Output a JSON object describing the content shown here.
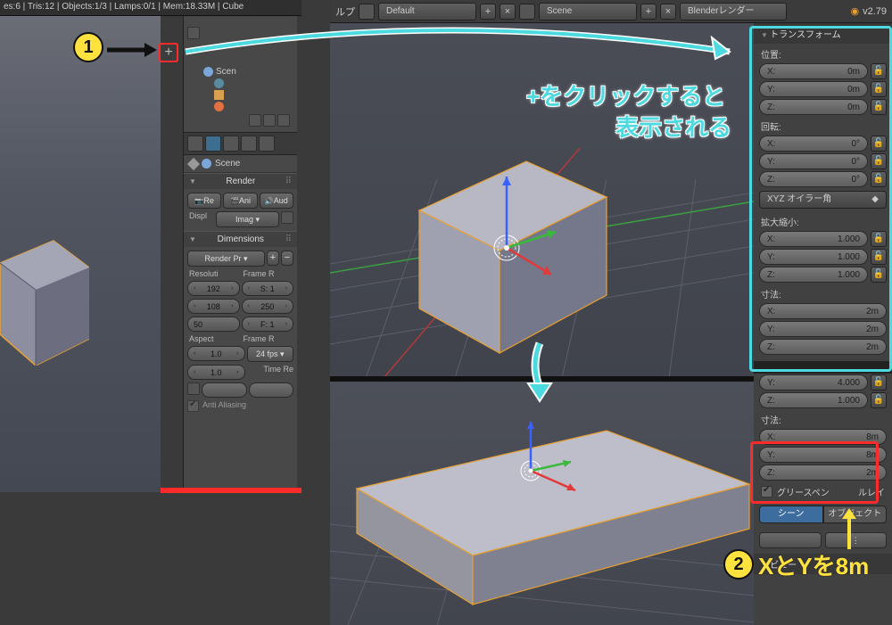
{
  "status_bar": "es:6 | Tris:12 | Objects:1/3 | Lamps:0/1 | Mem:18.33M | Cube",
  "header": {
    "help": "ルプ",
    "layout_label": "Default",
    "scene_label": "Scene",
    "renderer": "Blenderレンダー",
    "version": "v2.79"
  },
  "outliner": {
    "scene": "Scen",
    "scene_label_pin": "Scene"
  },
  "render_panel": {
    "title": "Render",
    "btn_render": "Re",
    "btn_anim": "Ani",
    "btn_audio": "Aud",
    "display_label": "Displ",
    "display_value": "Imag"
  },
  "dimensions_panel": {
    "title": "Dimensions",
    "preset": "Render Pr",
    "resolution_label": "Resoluti",
    "frame_range_label": "Frame R",
    "res_x": "192",
    "res_y": "108",
    "res_pct": "50",
    "frame_start": "S: 1",
    "frame_end": "250",
    "frame_step": "F: 1",
    "aspect_label": "Aspect",
    "frame_rate_label": "Frame R",
    "aspect_x": "1.0",
    "aspect_y": "1.0",
    "fps": "24 fps",
    "time_remap": "Time Re",
    "anti_alias_label": "Anti Aliasing"
  },
  "transform": {
    "title": "トランスフォーム",
    "location_label": "位置:",
    "loc": {
      "x": "0m",
      "y": "0m",
      "z": "0m"
    },
    "rotation_label": "回転:",
    "rot": {
      "x": "0°",
      "y": "0°",
      "z": "0°"
    },
    "rot_mode": "XYZ オイラー角",
    "scale_label": "拡大縮小:",
    "scale": {
      "x": "1.000",
      "y": "1.000",
      "z": "1.000"
    },
    "dim_label": "寸法:",
    "dim": {
      "x": "2m",
      "y": "2m",
      "z": "2m"
    }
  },
  "bottom_transform": {
    "scale_y": "4.000",
    "scale_z": "1.000",
    "dim_label": "寸法:",
    "dim": {
      "x": "8m",
      "y": "8m",
      "z": "2m"
    },
    "gp_label": "グリースペン",
    "gp_suffix": "ルレイ",
    "scene_tab": "シーン",
    "object_tab": "オブジェクト",
    "view_header": "ビュー"
  },
  "axis_labels": {
    "x": "X:",
    "y": "Y:",
    "z": "Z:"
  },
  "annotations": {
    "callout1": "+をクリックすると",
    "callout2": "表示される",
    "step2_text": "XとYを8m"
  }
}
